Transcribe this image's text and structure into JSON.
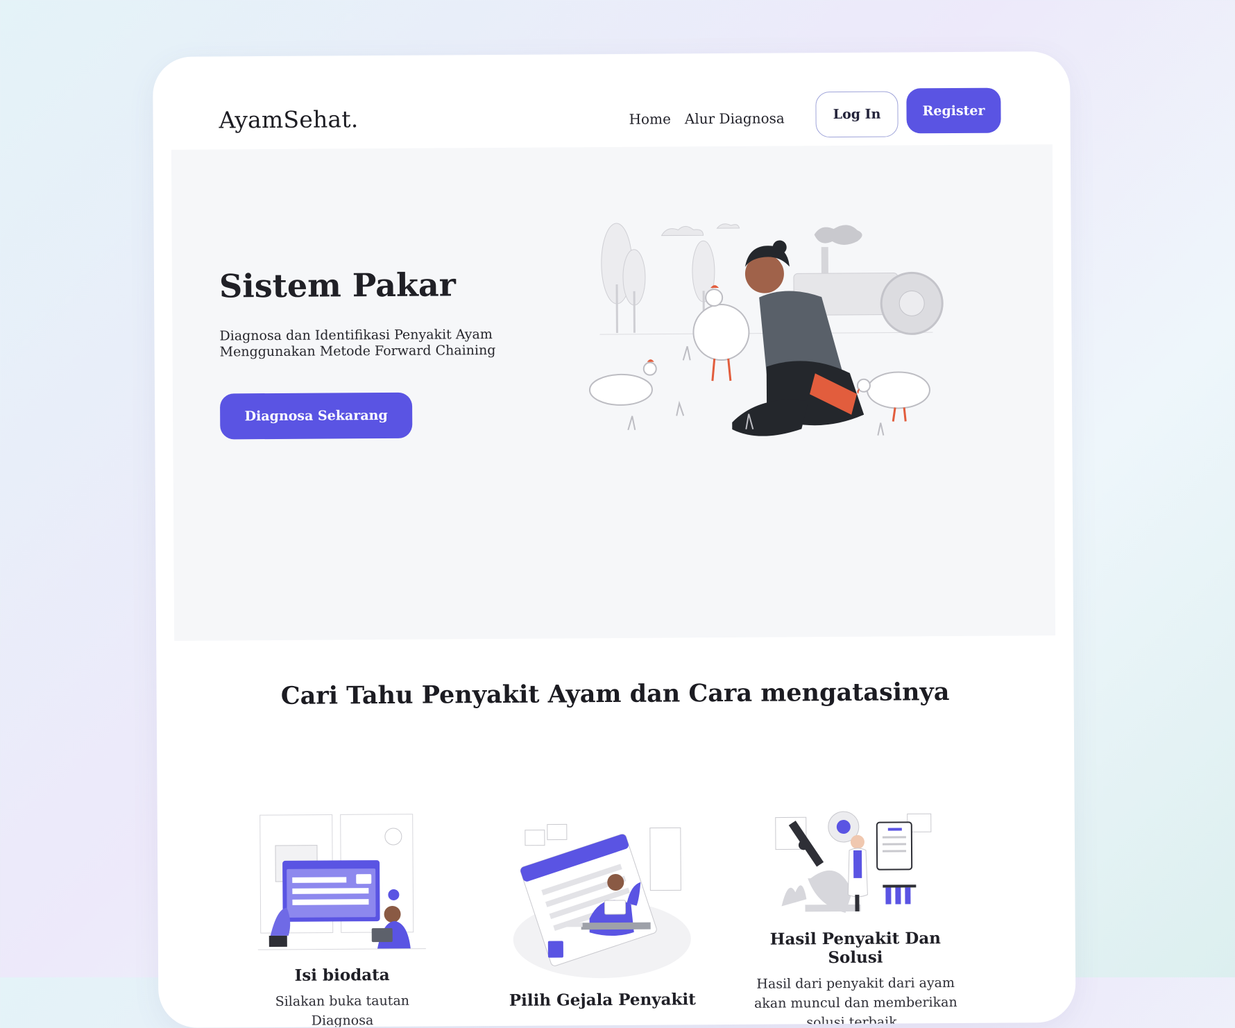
{
  "header": {
    "logo": "AyamSehat.",
    "nav": [
      "Home",
      "Alur Diagnosa"
    ],
    "login_label": "Log In",
    "register_label": "Register"
  },
  "hero": {
    "title": "Sistem Pakar",
    "subtitle": "Diagnosa dan Identifikasi Penyakit Ayam Menggunakan Metode Forward Chaining",
    "cta_label": "Diagnosa Sekarang"
  },
  "section": {
    "title": "Cari Tahu Penyakit Ayam dan Cara mengatasinya",
    "features": [
      {
        "title": "Isi biodata",
        "text": "Silakan buka tautan Diagnosa"
      },
      {
        "title": "Pilih Gejala Penyakit",
        "text": ""
      },
      {
        "title": "Hasil Penyakit Dan Solusi",
        "text": "Hasil dari penyakit dari ayam akan muncul dan memberikan solusi terbaik.."
      }
    ]
  },
  "colors": {
    "accent": "#5a54e3",
    "hero_bg": "#f6f7f9",
    "card_bg": "#ffffff"
  }
}
